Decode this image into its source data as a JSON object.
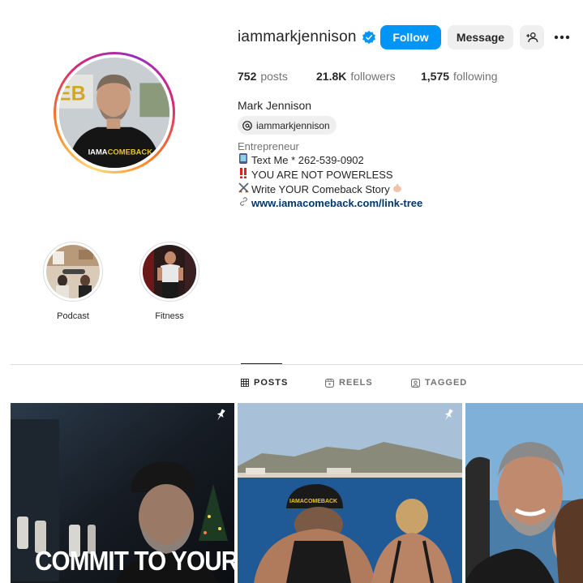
{
  "profile": {
    "username": "iammarkjennison",
    "verified": true,
    "full_name": "Mark Jennison",
    "threads_handle": "iammarkjennison",
    "buttons": {
      "follow": "Follow",
      "message": "Message"
    },
    "stats": {
      "posts_count": "752",
      "posts_label": "posts",
      "followers_count": "21.8K",
      "followers_label": "followers",
      "following_count": "1,575",
      "following_label": "following"
    },
    "bio": {
      "category": "Entrepreneur",
      "lines": [
        {
          "icon": "phone-emoji-icon",
          "text": "Text Me * 262-539-0902"
        },
        {
          "icon": "double-exclamation-emoji-icon",
          "text": " YOU ARE NOT POWERLESS"
        },
        {
          "icon": "swords-emoji-icon",
          "text": " Write YOUR Comeback Story"
        }
      ],
      "link": "www.iamacomeback.com/link-tree"
    },
    "avatar_shirt_text": "IAMACOMEBACK"
  },
  "highlights": [
    {
      "label": "Podcast"
    },
    {
      "label": "Fitness"
    }
  ],
  "tabs": [
    {
      "label": "POSTS",
      "icon": "grid-icon",
      "active": true
    },
    {
      "label": "REELS",
      "icon": "reels-icon",
      "active": false
    },
    {
      "label": "TAGGED",
      "icon": "tagged-icon",
      "active": false
    }
  ],
  "posts": [
    {
      "pinned": true,
      "overlay_text": "COMMIT TO YOUR"
    },
    {
      "pinned": true,
      "hat_text": "IAMACOMEBACK"
    },
    {
      "pinned": false
    }
  ],
  "colors": {
    "follow_button": "#0095f6",
    "verified_badge": "#0095f6",
    "link": "#00376b",
    "muted_text": "#737373"
  }
}
